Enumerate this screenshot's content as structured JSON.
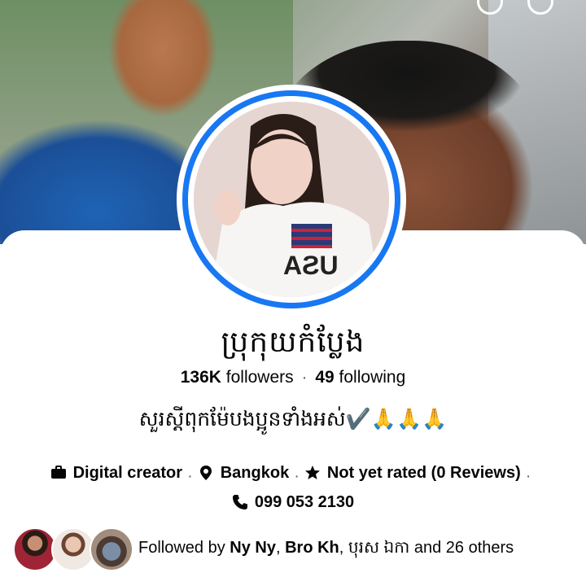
{
  "profile": {
    "name": "ប្រុកុយកំប្លែង",
    "followers_count": "136K",
    "followers_label": "followers",
    "following_count": "49",
    "following_label": "following",
    "bio": "សួរស្តីពុកម៉ែបងប្អូនទាំងអស់✔️🙏🙏🙏",
    "category": "Digital creator",
    "location": "Bangkok",
    "rating": "Not yet rated (0 Reviews)",
    "phone": "099 053 2130"
  },
  "followed_by": {
    "prefix": "Followed by",
    "names": [
      "Ny Ny",
      "Bro Kh",
      "បុរស ឯកា"
    ],
    "suffix": "and 26 others"
  },
  "icons": {
    "category": "briefcase-icon",
    "location": "location-pin-icon",
    "rating": "star-icon",
    "phone": "phone-icon"
  },
  "colors": {
    "accent": "#1877f2",
    "text": "#050505",
    "secondary": "#65676b"
  }
}
